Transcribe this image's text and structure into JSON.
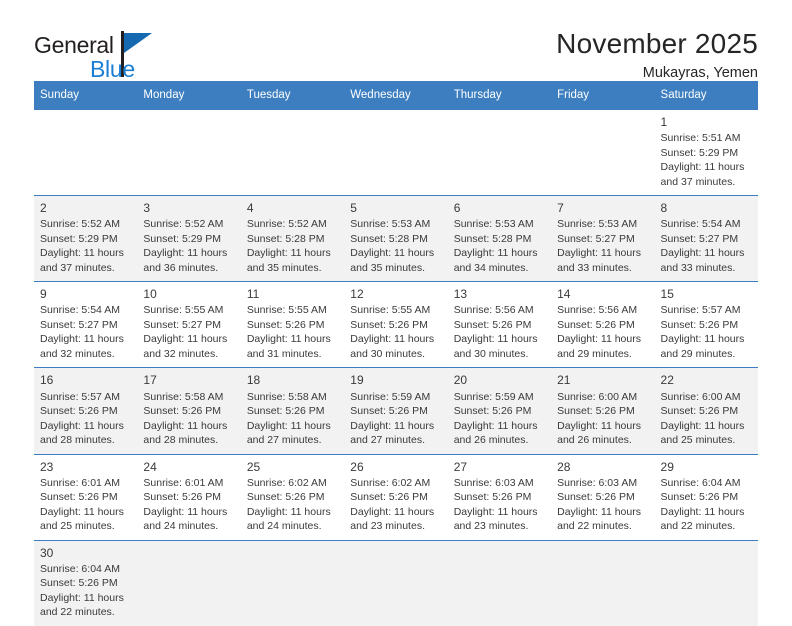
{
  "brand": {
    "name_part1": "General",
    "name_part2": "Blue",
    "flag_color": "#1569b0",
    "blue_color": "#1a7fd4"
  },
  "header": {
    "month_title": "November 2025",
    "location": "Mukayras, Yemen"
  },
  "theme": {
    "header_row_bg": "#3c7ebf",
    "alt_row_bg": "#f2f2f2",
    "grid_line": "#3c7ebf",
    "text": "#3a3a3a"
  },
  "weekday_headers": [
    "Sunday",
    "Monday",
    "Tuesday",
    "Wednesday",
    "Thursday",
    "Friday",
    "Saturday"
  ],
  "weeks": [
    [
      {
        "day": ""
      },
      {
        "day": ""
      },
      {
        "day": ""
      },
      {
        "day": ""
      },
      {
        "day": ""
      },
      {
        "day": ""
      },
      {
        "day": "1",
        "sunrise": "Sunrise: 5:51 AM",
        "sunset": "Sunset: 5:29 PM",
        "daylight_line1": "Daylight: 11 hours",
        "daylight_line2": "and 37 minutes."
      }
    ],
    [
      {
        "day": "2",
        "sunrise": "Sunrise: 5:52 AM",
        "sunset": "Sunset: 5:29 PM",
        "daylight_line1": "Daylight: 11 hours",
        "daylight_line2": "and 37 minutes."
      },
      {
        "day": "3",
        "sunrise": "Sunrise: 5:52 AM",
        "sunset": "Sunset: 5:29 PM",
        "daylight_line1": "Daylight: 11 hours",
        "daylight_line2": "and 36 minutes."
      },
      {
        "day": "4",
        "sunrise": "Sunrise: 5:52 AM",
        "sunset": "Sunset: 5:28 PM",
        "daylight_line1": "Daylight: 11 hours",
        "daylight_line2": "and 35 minutes."
      },
      {
        "day": "5",
        "sunrise": "Sunrise: 5:53 AM",
        "sunset": "Sunset: 5:28 PM",
        "daylight_line1": "Daylight: 11 hours",
        "daylight_line2": "and 35 minutes."
      },
      {
        "day": "6",
        "sunrise": "Sunrise: 5:53 AM",
        "sunset": "Sunset: 5:28 PM",
        "daylight_line1": "Daylight: 11 hours",
        "daylight_line2": "and 34 minutes."
      },
      {
        "day": "7",
        "sunrise": "Sunrise: 5:53 AM",
        "sunset": "Sunset: 5:27 PM",
        "daylight_line1": "Daylight: 11 hours",
        "daylight_line2": "and 33 minutes."
      },
      {
        "day": "8",
        "sunrise": "Sunrise: 5:54 AM",
        "sunset": "Sunset: 5:27 PM",
        "daylight_line1": "Daylight: 11 hours",
        "daylight_line2": "and 33 minutes."
      }
    ],
    [
      {
        "day": "9",
        "sunrise": "Sunrise: 5:54 AM",
        "sunset": "Sunset: 5:27 PM",
        "daylight_line1": "Daylight: 11 hours",
        "daylight_line2": "and 32 minutes."
      },
      {
        "day": "10",
        "sunrise": "Sunrise: 5:55 AM",
        "sunset": "Sunset: 5:27 PM",
        "daylight_line1": "Daylight: 11 hours",
        "daylight_line2": "and 32 minutes."
      },
      {
        "day": "11",
        "sunrise": "Sunrise: 5:55 AM",
        "sunset": "Sunset: 5:26 PM",
        "daylight_line1": "Daylight: 11 hours",
        "daylight_line2": "and 31 minutes."
      },
      {
        "day": "12",
        "sunrise": "Sunrise: 5:55 AM",
        "sunset": "Sunset: 5:26 PM",
        "daylight_line1": "Daylight: 11 hours",
        "daylight_line2": "and 30 minutes."
      },
      {
        "day": "13",
        "sunrise": "Sunrise: 5:56 AM",
        "sunset": "Sunset: 5:26 PM",
        "daylight_line1": "Daylight: 11 hours",
        "daylight_line2": "and 30 minutes."
      },
      {
        "day": "14",
        "sunrise": "Sunrise: 5:56 AM",
        "sunset": "Sunset: 5:26 PM",
        "daylight_line1": "Daylight: 11 hours",
        "daylight_line2": "and 29 minutes."
      },
      {
        "day": "15",
        "sunrise": "Sunrise: 5:57 AM",
        "sunset": "Sunset: 5:26 PM",
        "daylight_line1": "Daylight: 11 hours",
        "daylight_line2": "and 29 minutes."
      }
    ],
    [
      {
        "day": "16",
        "sunrise": "Sunrise: 5:57 AM",
        "sunset": "Sunset: 5:26 PM",
        "daylight_line1": "Daylight: 11 hours",
        "daylight_line2": "and 28 minutes."
      },
      {
        "day": "17",
        "sunrise": "Sunrise: 5:58 AM",
        "sunset": "Sunset: 5:26 PM",
        "daylight_line1": "Daylight: 11 hours",
        "daylight_line2": "and 28 minutes."
      },
      {
        "day": "18",
        "sunrise": "Sunrise: 5:58 AM",
        "sunset": "Sunset: 5:26 PM",
        "daylight_line1": "Daylight: 11 hours",
        "daylight_line2": "and 27 minutes."
      },
      {
        "day": "19",
        "sunrise": "Sunrise: 5:59 AM",
        "sunset": "Sunset: 5:26 PM",
        "daylight_line1": "Daylight: 11 hours",
        "daylight_line2": "and 27 minutes."
      },
      {
        "day": "20",
        "sunrise": "Sunrise: 5:59 AM",
        "sunset": "Sunset: 5:26 PM",
        "daylight_line1": "Daylight: 11 hours",
        "daylight_line2": "and 26 minutes."
      },
      {
        "day": "21",
        "sunrise": "Sunrise: 6:00 AM",
        "sunset": "Sunset: 5:26 PM",
        "daylight_line1": "Daylight: 11 hours",
        "daylight_line2": "and 26 minutes."
      },
      {
        "day": "22",
        "sunrise": "Sunrise: 6:00 AM",
        "sunset": "Sunset: 5:26 PM",
        "daylight_line1": "Daylight: 11 hours",
        "daylight_line2": "and 25 minutes."
      }
    ],
    [
      {
        "day": "23",
        "sunrise": "Sunrise: 6:01 AM",
        "sunset": "Sunset: 5:26 PM",
        "daylight_line1": "Daylight: 11 hours",
        "daylight_line2": "and 25 minutes."
      },
      {
        "day": "24",
        "sunrise": "Sunrise: 6:01 AM",
        "sunset": "Sunset: 5:26 PM",
        "daylight_line1": "Daylight: 11 hours",
        "daylight_line2": "and 24 minutes."
      },
      {
        "day": "25",
        "sunrise": "Sunrise: 6:02 AM",
        "sunset": "Sunset: 5:26 PM",
        "daylight_line1": "Daylight: 11 hours",
        "daylight_line2": "and 24 minutes."
      },
      {
        "day": "26",
        "sunrise": "Sunrise: 6:02 AM",
        "sunset": "Sunset: 5:26 PM",
        "daylight_line1": "Daylight: 11 hours",
        "daylight_line2": "and 23 minutes."
      },
      {
        "day": "27",
        "sunrise": "Sunrise: 6:03 AM",
        "sunset": "Sunset: 5:26 PM",
        "daylight_line1": "Daylight: 11 hours",
        "daylight_line2": "and 23 minutes."
      },
      {
        "day": "28",
        "sunrise": "Sunrise: 6:03 AM",
        "sunset": "Sunset: 5:26 PM",
        "daylight_line1": "Daylight: 11 hours",
        "daylight_line2": "and 22 minutes."
      },
      {
        "day": "29",
        "sunrise": "Sunrise: 6:04 AM",
        "sunset": "Sunset: 5:26 PM",
        "daylight_line1": "Daylight: 11 hours",
        "daylight_line2": "and 22 minutes."
      }
    ],
    [
      {
        "day": "30",
        "sunrise": "Sunrise: 6:04 AM",
        "sunset": "Sunset: 5:26 PM",
        "daylight_line1": "Daylight: 11 hours",
        "daylight_line2": "and 22 minutes."
      },
      {
        "day": ""
      },
      {
        "day": ""
      },
      {
        "day": ""
      },
      {
        "day": ""
      },
      {
        "day": ""
      },
      {
        "day": ""
      }
    ]
  ]
}
